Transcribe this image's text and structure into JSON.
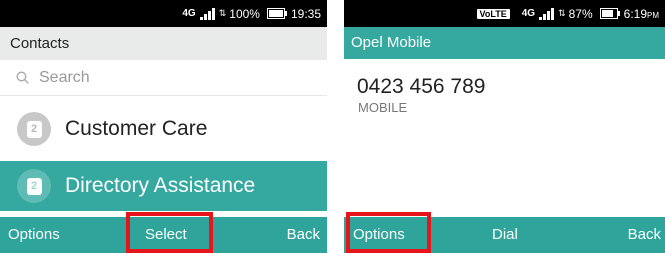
{
  "left_screen": {
    "status": {
      "network": "4G",
      "battery": "100%",
      "time": "19:35"
    },
    "header_title": "Contacts",
    "search_placeholder": "Search",
    "contacts": [
      {
        "name": "Customer Care",
        "avatar_icon": "sim-2-icon",
        "focused": false
      },
      {
        "name": "Directory Assistance",
        "avatar_icon": "sim-2-icon",
        "focused": true
      }
    ],
    "softkeys": {
      "left": "Options",
      "center": "Select",
      "right": "Back"
    },
    "highlighted_softkey": "center"
  },
  "right_screen": {
    "status": {
      "volte": "VoLTE",
      "network": "4G",
      "battery": "87%",
      "time": "6:19",
      "ampm": "PM"
    },
    "header_title": "Opel Mobile",
    "phone_number": "0423 456 789",
    "number_type": "MOBILE",
    "softkeys": {
      "left": "Options",
      "center": "Dial",
      "right": "Back"
    },
    "highlighted_softkey": "left"
  },
  "colors": {
    "accent": "#35a8a0",
    "softkey_bar": "#2fa49b",
    "highlight_box": "#e8141b"
  }
}
